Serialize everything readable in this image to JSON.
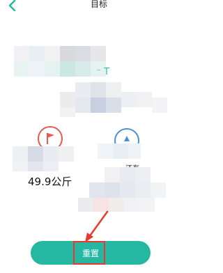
{
  "header": {
    "title": "目标",
    "back_icon": "chevron-left-icon"
  },
  "body": {
    "weight_value": "49.9公斤",
    "remain_label": "还有",
    "fragment_text": "⁻ T"
  },
  "actions": {
    "reset_label": "重置"
  },
  "colors": {
    "accent": "#26b7a2",
    "annotation_red": "#e63a2f"
  }
}
